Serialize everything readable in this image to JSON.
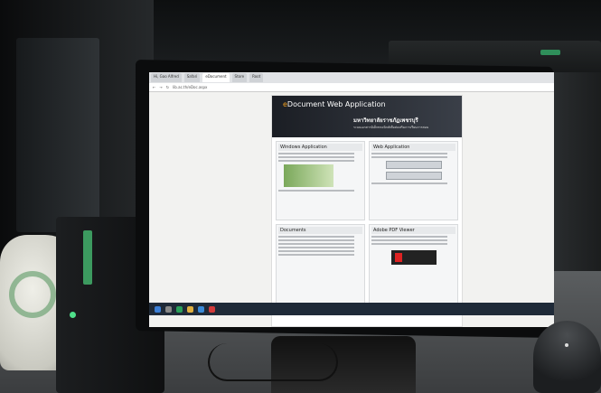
{
  "browser": {
    "tabs": [
      {
        "label": "Hi, Gao Alfred"
      },
      {
        "label": "Safari"
      },
      {
        "label": "eDocument"
      },
      {
        "label": "Store"
      },
      {
        "label": "Root"
      }
    ],
    "url": "lib.ac.th/eDoc.aspx"
  },
  "page": {
    "banner_logo": "eDocument",
    "banner_title_accent": "e",
    "banner_title_rest": "Document Web Application",
    "banner_thai": "มหาวิทยาลัยราชภัฏเพชรบุรี",
    "banner_thai_sub": "ระบบเอกสารอิเล็กทรอนิกส์เพื่อส่งเสริมการเรียนการสอน",
    "sections": [
      {
        "heading": "Windows Application"
      },
      {
        "heading": "Web Application"
      },
      {
        "heading": "Documents"
      },
      {
        "heading": "Adobe PDF Viewer"
      }
    ]
  },
  "colors": {
    "banner_bg": "#1b1e24",
    "accent": "#f0a020",
    "taskbar": "#1f2a38",
    "ups_stripe": "#3c9a5f"
  },
  "icons": [
    "windows-start-icon",
    "search-icon",
    "browser-icon",
    "folder-icon",
    "mail-icon",
    "pdf-icon"
  ]
}
